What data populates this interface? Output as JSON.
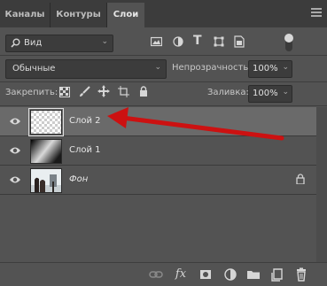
{
  "tabs": [
    {
      "label": "Каналы"
    },
    {
      "label": "Контуры"
    },
    {
      "label": "Слои"
    }
  ],
  "filter": {
    "label": "Вид"
  },
  "blend": {
    "mode": "Обычные",
    "opacity_label": "Непрозрачность:",
    "opacity_value": "100%"
  },
  "lock": {
    "label": "Закрепить:",
    "fill_label": "Заливка:",
    "fill_value": "100%"
  },
  "layers": [
    {
      "name": "Слой 2",
      "selected": true
    },
    {
      "name": "Слой 1",
      "selected": false
    },
    {
      "name": "Фон",
      "selected": false,
      "locked": true
    }
  ],
  "annotation": {
    "color": "#cc1111"
  },
  "colors": {
    "panel": "#535353",
    "selected_row": "#6a6a6a",
    "tabbar": "#3c3c3c"
  }
}
